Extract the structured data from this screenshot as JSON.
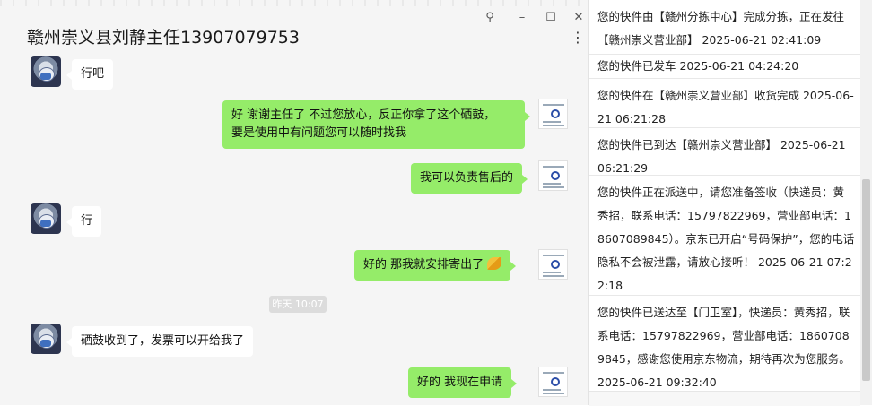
{
  "chat": {
    "title": "赣州崇义县刘静主任13907079753",
    "window_buttons": {
      "pin": "⚲",
      "minimize": "–",
      "maximize": "☐",
      "close": "✕"
    },
    "more_icon": "⋮",
    "timestamp": "昨天 10:07",
    "messages": [
      {
        "side": "in",
        "text": "行吧"
      },
      {
        "side": "out",
        "text": "好 谢谢主任了  不过您放心，反正你拿了这个硒鼓，\n要是使用中有问题您可以随时找我"
      },
      {
        "side": "out",
        "text": "我可以负责售后的"
      },
      {
        "side": "in",
        "text": "行"
      },
      {
        "side": "out",
        "text": "好的   那我就安排寄出了"
      },
      {
        "side": "in",
        "text": "硒鼓收到了，发票可以开给我了"
      },
      {
        "side": "out",
        "text": "好的     我现在申请"
      }
    ]
  },
  "tracking": {
    "rows": [
      "您的快件由【赣州分拣中心】完成分拣，正在发往【赣州崇义营业部】 2025-06-21 02:41:09",
      "您的快件已发车 2025-06-21 04:24:20",
      "您的快件在【赣州崇义营业部】收货完成 2025-06-21 06:21:28",
      "您的快件已到达【赣州崇义营业部】 2025-06-21 06:21:29",
      "您的快件正在派送中，请您准备签收（快递员：黄秀招，联系电话：15797822969，营业部电话：18607089845）。京东已开启“号码保护”，您的电话隐私不会被泄露，请放心接听！ 2025-06-21 07:22:18",
      "您的快件已送达至【门卫室】，快递员：黄秀招，联系电话：15797822969，营业部电话：18607089845，感谢您使用京东物流，期待再次为您服务。 2025-06-21 09:32:40"
    ]
  },
  "colors": {
    "bubble_out": "#95ec69",
    "bubble_in": "#ffffff",
    "chat_bg": "#f5f5f5"
  }
}
